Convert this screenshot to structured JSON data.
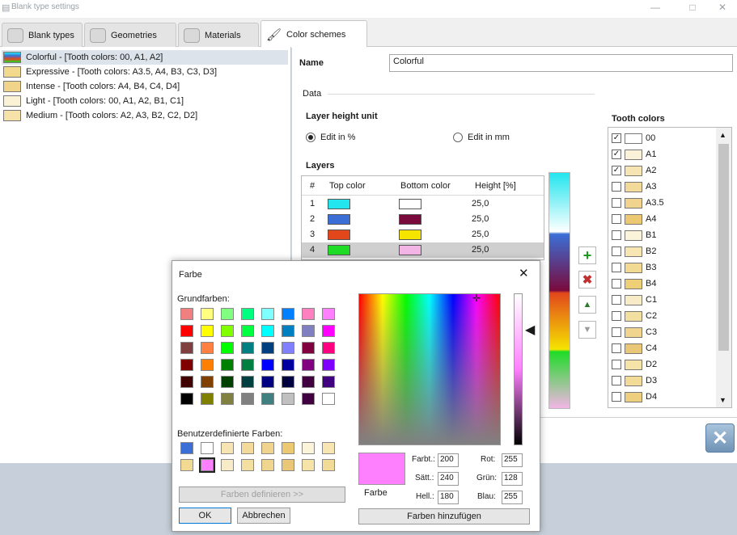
{
  "window": {
    "title": "Blank type settings"
  },
  "tabs": [
    {
      "label": "Blank types"
    },
    {
      "label": "Geometries"
    },
    {
      "label": "Materials"
    },
    {
      "label": "Color schemes"
    }
  ],
  "schemes": [
    {
      "label": "Colorful - [Tooth colors: 00, A1, A2]",
      "color": "#3a7bd5",
      "selected": true
    },
    {
      "label": "Expressive - [Tooth colors: A3.5, A4, B3, C3, D3]",
      "color": "#f3d98e"
    },
    {
      "label": "Intense - [Tooth colors: A4, B4, C4, D4]",
      "color": "#f0d48a"
    },
    {
      "label": "Light - [Tooth colors: 00, A1, A2, B1, C1]",
      "color": "#fbf1d4"
    },
    {
      "label": "Medium - [Tooth colors: A2, A3, B2, C2, D2]",
      "color": "#f6e2a8"
    }
  ],
  "form": {
    "name_label": "Name",
    "name_value": "Colorful",
    "data_group": "Data",
    "layer_height_unit": "Layer height unit",
    "edit_percent": "Edit in %",
    "edit_mm": "Edit in mm",
    "layers_label": "Layers",
    "columns": {
      "num": "#",
      "top": "Top color",
      "bottom": "Bottom color",
      "height": "Height [%]"
    },
    "layers": [
      {
        "num": "1",
        "top": "#22e5ee",
        "bottom": "#ffffff",
        "height": "25,0"
      },
      {
        "num": "2",
        "top": "#3b6fd6",
        "bottom": "#7a0a3c",
        "height": "25,0"
      },
      {
        "num": "3",
        "top": "#e2471c",
        "bottom": "#f5e400",
        "height": "25,0"
      },
      {
        "num": "4",
        "top": "#1fdc27",
        "bottom": "#f3b5e6",
        "height": "25,0",
        "selected": true
      }
    ]
  },
  "tooth_colors": {
    "title": "Tooth colors",
    "items": [
      {
        "label": "00",
        "checked": true,
        "color": "#ffffff"
      },
      {
        "label": "A1",
        "checked": true,
        "color": "#fbf1d8"
      },
      {
        "label": "A2",
        "checked": true,
        "color": "#f7e4b3"
      },
      {
        "label": "A3",
        "checked": false,
        "color": "#f3d99a"
      },
      {
        "label": "A3.5",
        "checked": false,
        "color": "#f0d38c"
      },
      {
        "label": "A4",
        "checked": false,
        "color": "#ecc870"
      },
      {
        "label": "B1",
        "checked": false,
        "color": "#fbf3da"
      },
      {
        "label": "B2",
        "checked": false,
        "color": "#f7e6b2"
      },
      {
        "label": "B3",
        "checked": false,
        "color": "#f3da92"
      },
      {
        "label": "B4",
        "checked": false,
        "color": "#efcf75"
      },
      {
        "label": "C1",
        "checked": false,
        "color": "#f8ecc8"
      },
      {
        "label": "C2",
        "checked": false,
        "color": "#f3df9f"
      },
      {
        "label": "C3",
        "checked": false,
        "color": "#efd58e"
      },
      {
        "label": "C4",
        "checked": false,
        "color": "#e9c777"
      },
      {
        "label": "D2",
        "checked": false,
        "color": "#f5e3a7"
      },
      {
        "label": "D3",
        "checked": false,
        "color": "#f1db96"
      },
      {
        "label": "D4",
        "checked": false,
        "color": "#ecd07f"
      }
    ]
  },
  "dialog": {
    "title": "Farbe",
    "basic_colors_label": "Grundfarben:",
    "basic_colors": [
      "#f08080",
      "#ffff80",
      "#80ff80",
      "#00ff80",
      "#80ffff",
      "#0080ff",
      "#ff80c0",
      "#ff80ff",
      "#ff0000",
      "#ffff00",
      "#80ff00",
      "#00ff40",
      "#00ffff",
      "#0080c0",
      "#8080c0",
      "#ff00ff",
      "#804040",
      "#ff8040",
      "#00ff00",
      "#008080",
      "#004080",
      "#8080ff",
      "#800040",
      "#ff0080",
      "#800000",
      "#ff8000",
      "#008000",
      "#008040",
      "#0000ff",
      "#0000a0",
      "#800080",
      "#8000ff",
      "#400000",
      "#804000",
      "#004000",
      "#004040",
      "#000080",
      "#000040",
      "#400040",
      "#400080",
      "#000000",
      "#808000",
      "#808040",
      "#808080",
      "#408080",
      "#c0c0c0",
      "#400040",
      "#ffffff"
    ],
    "custom_colors_label": "Benutzerdefinierte Farben:",
    "custom_colors": [
      "#3b6fd6",
      "#ffffff",
      "#f7e4b3",
      "#f3d99a",
      "#f0d38c",
      "#ecc870",
      "#fbf3da",
      "#f7e6b2",
      "#f3da92",
      "#ff80ff",
      "#f8ecc8",
      "#f3df9f",
      "#efd58e",
      "#e9c777",
      "#f5e3a7",
      "#f1db96"
    ],
    "define_custom": "Farben definieren >>",
    "ok": "OK",
    "cancel": "Abbrechen",
    "preview_color": "#ff80ff",
    "preview_label": "Farbe",
    "hue_label": "Farbt.:",
    "sat_label": "Sätt.:",
    "lum_label": "Hell.:",
    "red_label": "Rot:",
    "green_label": "Grün:",
    "blue_label": "Blau:",
    "hue": "200",
    "sat": "240",
    "lum": "180",
    "red": "255",
    "green": "128",
    "blue": "255",
    "add_custom": "Farben hinzufügen"
  }
}
